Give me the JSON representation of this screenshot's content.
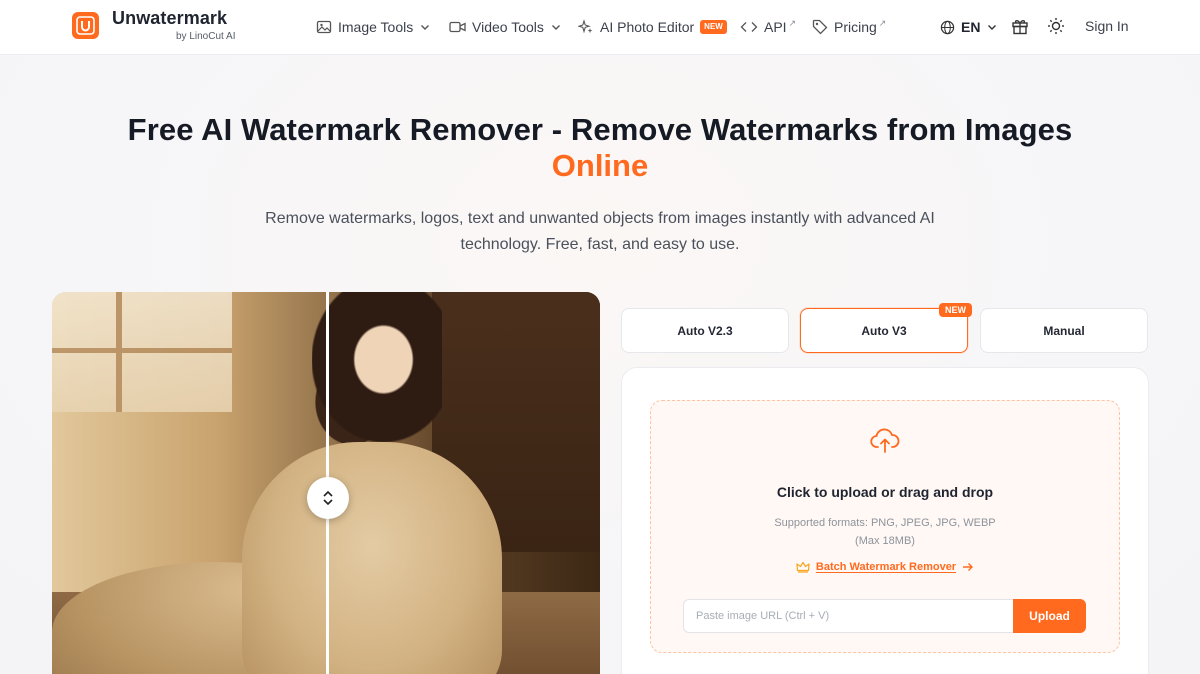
{
  "brand": {
    "name": "Unwatermark",
    "sub": "by LinoCut AI"
  },
  "nav": {
    "image_tools": "Image Tools",
    "video_tools": "Video Tools",
    "ai_photo_editor": "AI Photo Editor",
    "new_badge": "NEW",
    "api": "API",
    "pricing": "Pricing",
    "lang": "EN",
    "sign_in": "Sign In"
  },
  "hero": {
    "title": "Free AI Watermark Remover - Remove Watermarks from Images",
    "title_highlight": "Online",
    "subtitle": "Remove watermarks, logos, text and unwanted objects from images instantly with advanced AI technology. Free, fast, and easy to use."
  },
  "tabs": [
    {
      "label": "Auto V2.3"
    },
    {
      "label": "Auto V3",
      "badge": "NEW"
    },
    {
      "label": "Manual"
    }
  ],
  "upload": {
    "title": "Click to upload or drag and drop",
    "formats": "Supported formats: PNG, JPEG, JPG, WEBP",
    "max": "(Max 18MB)",
    "batch": "Batch Watermark Remover",
    "url_placeholder": "Paste image URL (Ctrl + V)",
    "button": "Upload"
  },
  "colors": {
    "accent": "#ff6a1f",
    "text": "#1f2430"
  }
}
